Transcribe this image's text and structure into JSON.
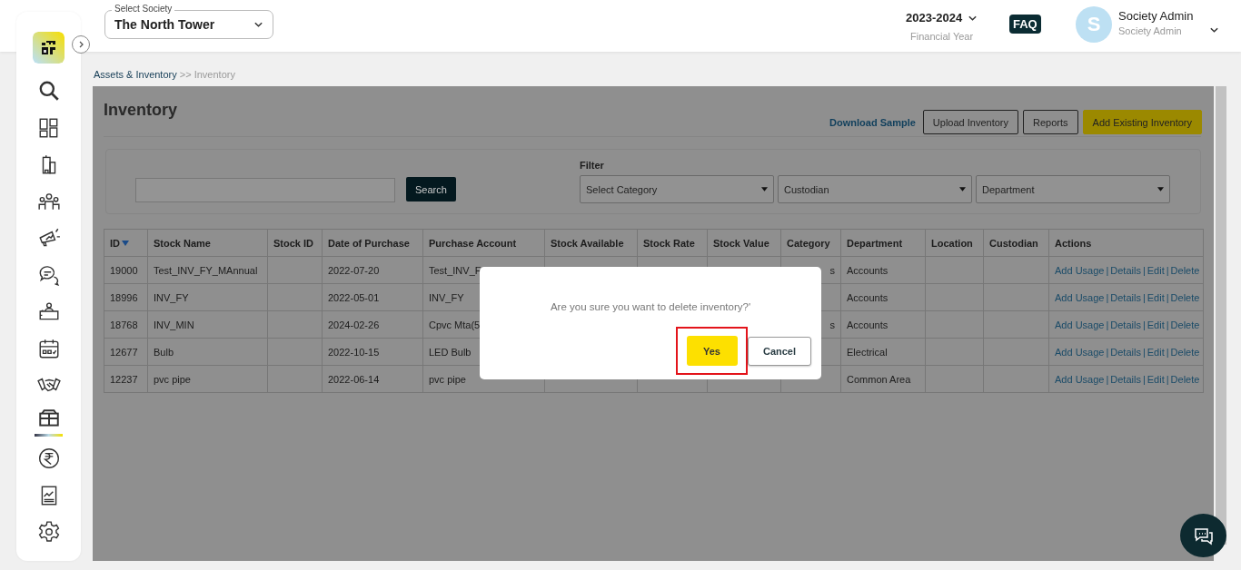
{
  "sidebar": {
    "items": [
      {
        "kind": "search",
        "selected": false
      },
      {
        "kind": "grid",
        "selected": false
      },
      {
        "kind": "building",
        "selected": false
      },
      {
        "kind": "people",
        "selected": false
      },
      {
        "kind": "megaphone",
        "selected": false
      },
      {
        "kind": "chat",
        "selected": false
      },
      {
        "kind": "desk",
        "selected": false
      },
      {
        "kind": "calendar",
        "selected": false
      },
      {
        "kind": "handshake",
        "selected": false
      },
      {
        "kind": "box",
        "selected": true
      },
      {
        "kind": "rupee",
        "selected": false
      },
      {
        "kind": "report",
        "selected": false
      },
      {
        "kind": "settings",
        "selected": false
      }
    ]
  },
  "header": {
    "society_select": {
      "label": "Select Society",
      "value": "The North Tower"
    },
    "financial_year": {
      "value": "2023-2024",
      "caption": "Financial Year"
    },
    "faq": "FAQ",
    "user": {
      "initial": "S",
      "name": "Society Admin",
      "role": "Society Admin"
    }
  },
  "breadcrumb": {
    "parent": "Assets & Inventory",
    "current": ">> Inventory"
  },
  "page": {
    "title": "Inventory",
    "download_link": "Download Sample",
    "buttons": [
      {
        "label": "Upload Inventory",
        "kind": "outline"
      },
      {
        "label": "Reports",
        "kind": "outline"
      },
      {
        "label": "Add Existing Inventory",
        "kind": "primary"
      }
    ]
  },
  "search": {
    "button": "Search"
  },
  "filter": {
    "label": "Filter",
    "selects": [
      "Select Category",
      "Custodian",
      "Department"
    ]
  },
  "table": {
    "columns": [
      {
        "label": "ID",
        "sorted": true
      },
      {
        "label": "Stock Name",
        "sorted": false
      },
      {
        "label": "Stock ID",
        "sorted": false
      },
      {
        "label": "Date of Purchase",
        "sorted": false
      },
      {
        "label": "Purchase Account",
        "sorted": false
      },
      {
        "label": "Stock Available",
        "sorted": false
      },
      {
        "label": "Stock Rate",
        "sorted": false
      },
      {
        "label": "Stock Value",
        "sorted": false
      },
      {
        "label": "Category",
        "sorted": false
      },
      {
        "label": "Department",
        "sorted": false
      },
      {
        "label": "Location",
        "sorted": false
      },
      {
        "label": "Custodian",
        "sorted": false
      },
      {
        "label": "Actions",
        "sorted": false
      }
    ],
    "rows": [
      {
        "cells": [
          "19000",
          "Test_INV_FY_MAnnual",
          "",
          "2022-07-20",
          "Test_INV_F",
          "",
          "",
          "",
          "s",
          "Accounts",
          "",
          ""
        ],
        "actions": [
          "Add Usage",
          "Details",
          "Edit",
          "Delete"
        ],
        "separators": [
          "|",
          "|",
          "|"
        ]
      },
      {
        "cells": [
          "18996",
          "INV_FY",
          "",
          "2022-05-01",
          "INV_FY",
          "",
          "",
          "",
          "",
          "Accounts",
          "",
          ""
        ],
        "actions": [
          "Add Usage",
          "Details",
          "Edit",
          "Delete"
        ],
        "separators": [
          "|",
          "|",
          "|"
        ]
      },
      {
        "cells": [
          "18768",
          "INV_MIN",
          "",
          "2024-02-26",
          "Cpvc Mta(5",
          "",
          "",
          "",
          "s",
          "Accounts",
          "",
          ""
        ],
        "actions": [
          "Add Usage",
          "Details",
          "Edit",
          "Delete"
        ],
        "separators": [
          "|",
          "|",
          "|"
        ]
      },
      {
        "cells": [
          "12677",
          "Bulb",
          "",
          "2022-10-15",
          "LED Bulb",
          "",
          "",
          "",
          "",
          "Electrical",
          "",
          ""
        ],
        "actions": [
          "Add Usage",
          "Details",
          "Edit",
          "Delete"
        ],
        "separators": [
          "|",
          "|",
          "|"
        ]
      },
      {
        "cells": [
          "12237",
          "pvc pipe",
          "",
          "2022-06-14",
          "pvc pipe",
          "",
          "",
          "",
          "",
          "Common Area",
          "",
          ""
        ],
        "actions": [
          "Add Usage",
          "Details",
          "Edit",
          "Delete"
        ],
        "separators": [
          "|",
          "|",
          "|"
        ]
      }
    ]
  },
  "dialog": {
    "message": "Are you sure you want to delete inventory?'",
    "confirm": "Yes",
    "cancel": "Cancel",
    "confirm_highlighted": true
  }
}
